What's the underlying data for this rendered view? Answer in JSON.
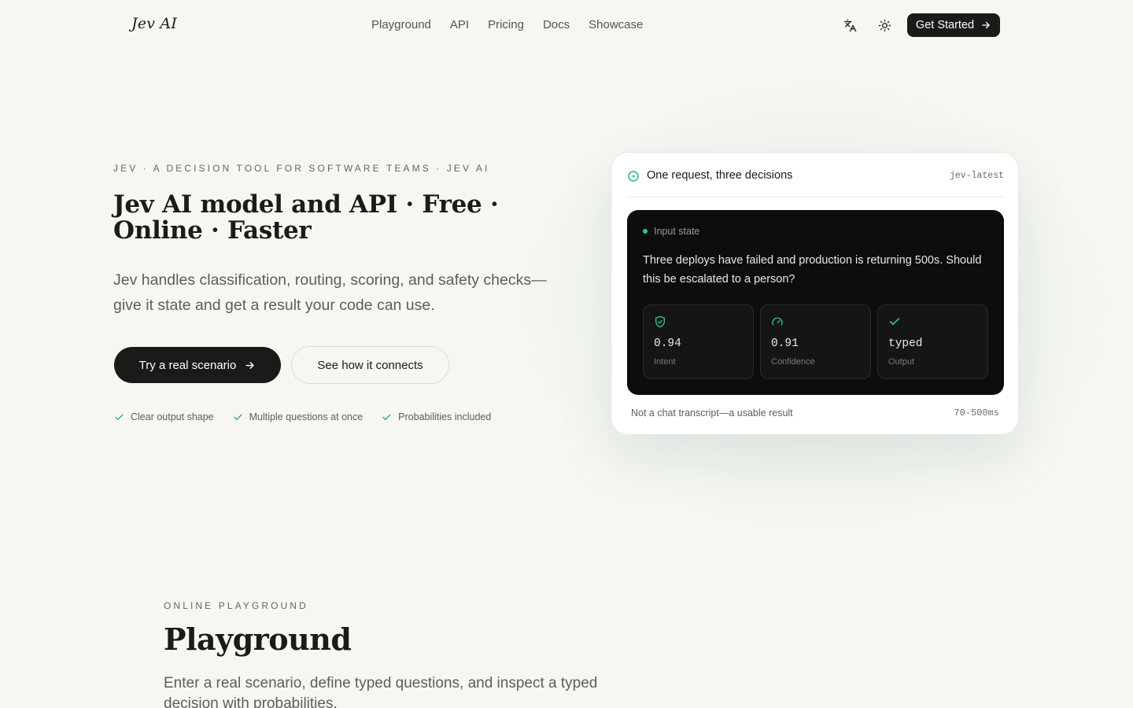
{
  "header": {
    "logo": "Jev AI",
    "nav": [
      "Playground",
      "API",
      "Pricing",
      "Docs",
      "Showcase"
    ],
    "language_icon": "translate-icon",
    "theme_icon": "sun-icon",
    "cta": "Get Started"
  },
  "hero": {
    "eyebrow": "JEV · A DECISION TOOL FOR SOFTWARE TEAMS · JEV AI",
    "title": "Jev AI model and API · Free · Online · Faster",
    "subtitle": "Jev handles classification, routing, scoring, and safety checks—give it state and get a result your code can use.",
    "primary_button": "Try a real scenario",
    "secondary_button": "See how it connects",
    "checks": [
      "Clear output shape",
      "Multiple questions at once",
      "Probabilities included"
    ]
  },
  "card": {
    "title": "One request, three decisions",
    "model_tag": "jev-latest",
    "input_label": "Input state",
    "input_text": "Three deploys have failed and production is returning 500s. Should this be escalated to a person?",
    "metrics": [
      {
        "icon": "shield-check-icon",
        "value": "0.94",
        "label": "Intent"
      },
      {
        "icon": "gauge-icon",
        "value": "0.91",
        "label": "Confidence"
      },
      {
        "icon": "check-icon",
        "value": "typed",
        "label": "Output"
      }
    ],
    "footer_left": "Not a chat transcript—a usable result",
    "footer_right": "70-500ms"
  },
  "playground": {
    "eyebrow": "ONLINE PLAYGROUND",
    "title": "Playground",
    "subtitle": "Enter a real scenario, define typed questions, and inspect a typed decision with probabilities."
  },
  "colors": {
    "background": "#f7f6f2",
    "dark": "#1b1a18",
    "accent_green": "#34c58e"
  }
}
